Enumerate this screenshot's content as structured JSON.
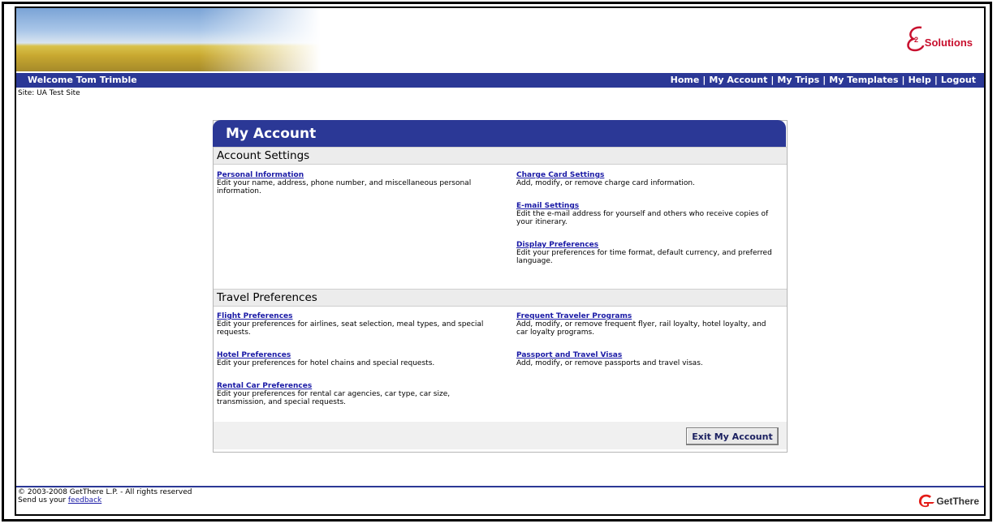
{
  "header": {
    "logo_text": "Solutions",
    "welcome": "Welcome Tom Trimble",
    "nav": [
      "Home",
      "My Account",
      "My Trips",
      "My Templates",
      "Help",
      "Logout"
    ],
    "site": "Site: UA Test Site"
  },
  "panel": {
    "title": "My Account",
    "account_settings": {
      "heading": "Account Settings",
      "left": [
        {
          "title": "Personal Information",
          "desc": "Edit your name, address, phone number, and miscellaneous personal information."
        }
      ],
      "right": [
        {
          "title": "Charge Card Settings",
          "desc": "Add, modify, or remove charge card information."
        },
        {
          "title": "E-mail Settings",
          "desc": "Edit the e-mail address for yourself and others who receive copies of your itinerary."
        },
        {
          "title": "Display Preferences",
          "desc": "Edit your preferences for time format, default currency, and preferred language."
        }
      ]
    },
    "travel_preferences": {
      "heading": "Travel Preferences",
      "left": [
        {
          "title": "Flight Preferences",
          "desc": "Edit your preferences for airlines, seat selection, meal types, and special requests."
        },
        {
          "title": "Hotel Preferences",
          "desc": "Edit your preferences for hotel chains and special requests."
        },
        {
          "title": "Rental Car Preferences",
          "desc": "Edit your preferences for rental car agencies, car type, car size, transmission, and special requests."
        }
      ],
      "right": [
        {
          "title": "Frequent Traveler Programs",
          "desc": "Add, modify, or remove frequent flyer, rail loyalty, hotel loyalty, and car loyalty programs."
        },
        {
          "title": "Passport and Travel Visas",
          "desc": "Add, modify, or remove passports and travel visas."
        }
      ]
    },
    "exit_button": "Exit My Account"
  },
  "footer": {
    "copyright": "© 2003-2008 GetThere L.P. - All rights reserved",
    "feedback_prefix": "Send us your ",
    "feedback_link": "feedback",
    "logo_text": "GetThere"
  },
  "colors": {
    "nav_blue": "#2b3896",
    "link_blue": "#1a1aa6",
    "brand_red": "#c8102e"
  }
}
